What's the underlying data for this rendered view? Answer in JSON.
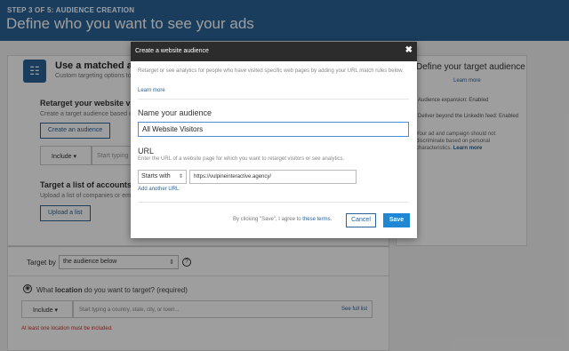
{
  "header": {
    "step": "STEP 3 OF 5: AUDIENCE CREATION",
    "title": "Define who you want to see your ads"
  },
  "background": {
    "matched_title": "Use a matched audie",
    "matched_subtitle": "Custom targeting options to r",
    "retarget_title": "Retarget your website visitors",
    "retarget_desc": "Create a target audience based o",
    "create_audience_btn": "Create an audience",
    "include_label": "Include",
    "type_placeholder": "Start typing",
    "target_list_title": "Target a list of accounts or c",
    "target_list_desc": "Upload a list of companies or em",
    "upload_btn": "Upload a list"
  },
  "right_panel": {
    "title": "Define your target audience",
    "learn_more": "Learn more",
    "expansion": "Audience expansion: Enabled",
    "linkedin_feed": "Deliver beyond the LinkedIn feed: Enabled",
    "note": "Your ad and campaign should not discriminate based on personal characteristics.",
    "note_link": "Learn more"
  },
  "target_by": {
    "label": "Target by",
    "selected": "the audience below"
  },
  "location": {
    "question_pre": "What ",
    "question_bold": "location",
    "question_post": " do you want to target? (required)",
    "include_label": "Include",
    "placeholder": "Start typing a country, state, city, or town...",
    "full_list": "See full list",
    "error": "At least one location must be included."
  },
  "modal": {
    "title": "Create a website audience",
    "description": "Retarget or see analytics for people who have visited specific web pages by adding your URL match rules below.",
    "learn_more": "Learn more",
    "name_label": "Name your audience",
    "name_value": "All Website Visitors",
    "url_label": "URL",
    "url_desc": "Enter the URL of a website page for which you want to retarget visitors or see analytics.",
    "match_rule": "Starts with",
    "url_value": "https://vulpineinteractive.agency/",
    "add_url": "Add another URL",
    "agree_text": "By clicking \"Save\", I agree to ",
    "agree_link": "these terms",
    "agree_end": ".",
    "cancel": "Cancel",
    "save": "Save"
  },
  "colors": {
    "brand": "#2a6398",
    "save": "#1f87d3",
    "error": "#c9302c"
  }
}
